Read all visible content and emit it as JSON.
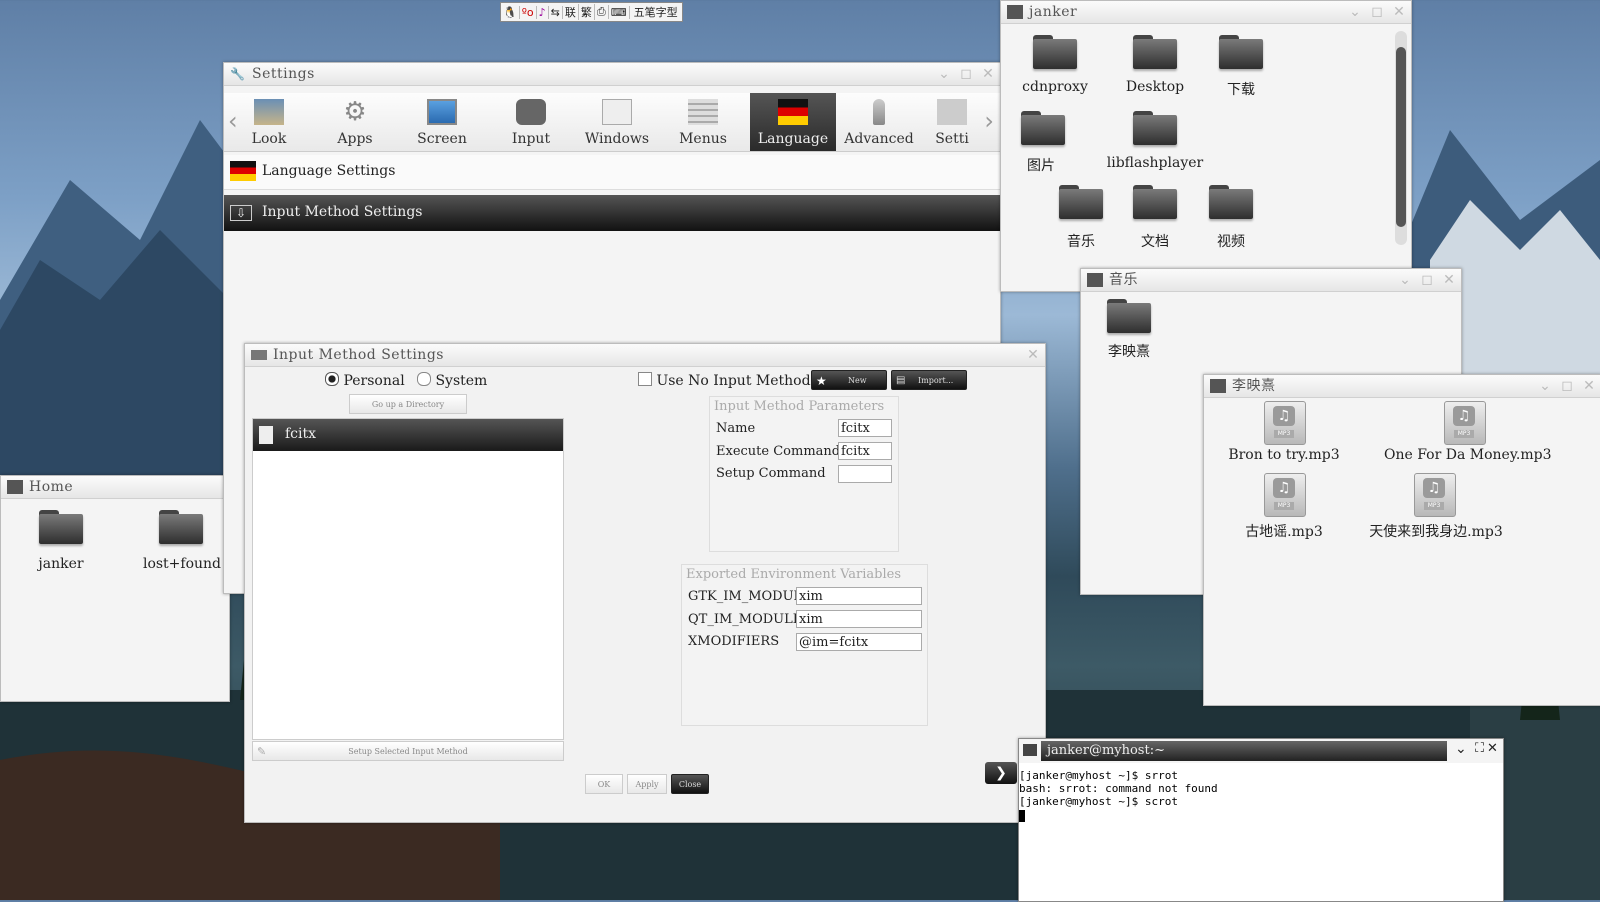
{
  "ime_bar": {
    "items": [
      "🐧",
      "ºo",
      "♪",
      "⇆",
      "联",
      "繁",
      "⎙",
      "⌨"
    ],
    "mode": "五笔字型"
  },
  "settings": {
    "title": "Settings",
    "toolbar": [
      "Look",
      "Apps",
      "Screen",
      "Input",
      "Windows",
      "Menus",
      "Language",
      "Advanced",
      "Setti"
    ],
    "active_tab": "Language",
    "section_title": "Language Settings",
    "subsection_title": "Input Method Settings"
  },
  "imsettings": {
    "title": "Input Method Settings",
    "radio_personal": "Personal",
    "radio_system": "System",
    "go_up": "Go up a Directory",
    "list": [
      "fcitx"
    ],
    "setup_selected": "Setup Selected Input Method",
    "use_no_im": "Use No Input Method",
    "new_btn": "New",
    "import_btn": "Import...",
    "params_title": "Input Method Parameters",
    "params": [
      {
        "label": "Name",
        "value": "fcitx"
      },
      {
        "label": "Execute Command",
        "value": "fcitx"
      },
      {
        "label": "Setup Command",
        "value": ""
      }
    ],
    "env_title": "Exported Environment Variables",
    "env": [
      {
        "label": "GTK_IM_MODULE",
        "value": "xim"
      },
      {
        "label": "QT_IM_MODULE",
        "value": "xim"
      },
      {
        "label": "XMODIFIERS",
        "value": "@im=fcitx"
      }
    ],
    "ok": "OK",
    "apply": "Apply",
    "close": "Close"
  },
  "janker_win": {
    "title": "janker",
    "items": [
      "cdnproxy",
      "Desktop",
      "下载",
      "图片",
      "libflashplayer",
      "音乐",
      "文档",
      "视频"
    ]
  },
  "music_win": {
    "title": "音乐",
    "items": [
      "李映熹"
    ]
  },
  "artist_win": {
    "title": "李映熹",
    "items": [
      "Bron to try.mp3",
      "One For Da Money.mp3",
      "古地谣.mp3",
      "天使来到我身边.mp3"
    ],
    "mp3_tag": "MP3"
  },
  "home_win": {
    "title": "Home",
    "items": [
      "janker",
      "lost+found"
    ]
  },
  "terminal": {
    "title": "janker@myhost:~",
    "lines": [
      "[janker@myhost ~]$ srrot",
      "bash: srrot: command not found",
      "[janker@myhost ~]$ scrot"
    ]
  },
  "colors": {
    "titlebar": "#eeeeee",
    "active_tab_bg": "#3a3a3a",
    "selection_bg": "#1c1c1c"
  }
}
